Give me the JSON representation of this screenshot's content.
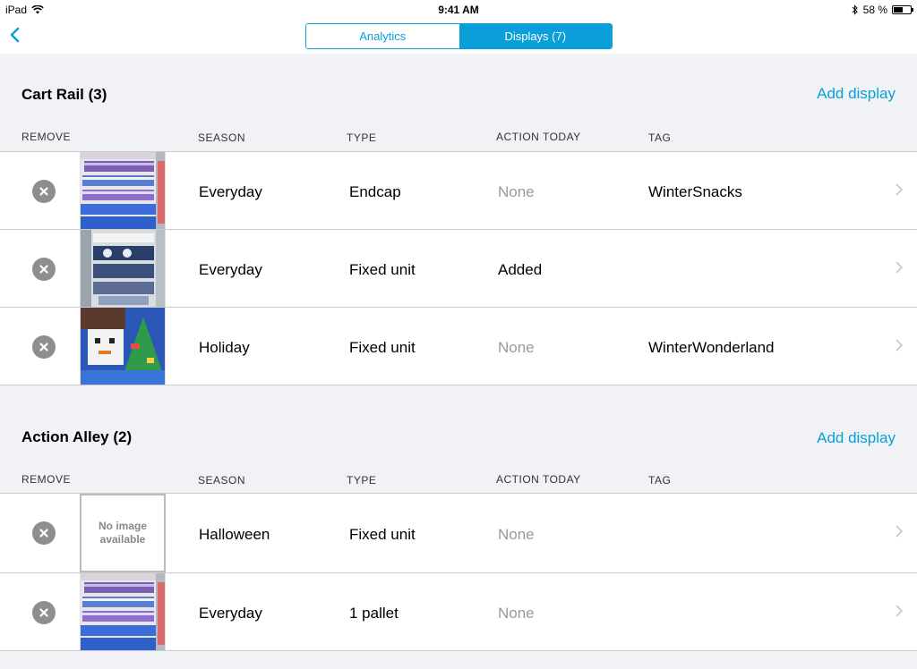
{
  "status": {
    "device": "iPad",
    "time": "9:41 AM",
    "battery": "58 %",
    "battery_level": 0.58
  },
  "nav": {
    "back_icon": "chevron-left-icon",
    "tabs": [
      {
        "label": "Analytics",
        "active": false
      },
      {
        "label": "Displays (7)",
        "active": true
      }
    ]
  },
  "columns": {
    "remove": "REMOVE",
    "season": "SEASON",
    "type": "TYPE",
    "action": "ACTION TODAY",
    "tag": "TAG"
  },
  "sections": [
    {
      "title": "Cart Rail (3)",
      "add_label": "Add display",
      "rows": [
        {
          "image": "shelf-blue",
          "season": "Everyday",
          "type": "Endcap",
          "action": "None",
          "tag": "WinterSnacks"
        },
        {
          "image": "shelf-cart",
          "season": "Everyday",
          "type": "Fixed unit",
          "action": "Added",
          "tag": ""
        },
        {
          "image": "holiday-display",
          "season": "Holiday",
          "type": "Fixed unit",
          "action": "None",
          "tag": "WinterWonderland"
        }
      ]
    },
    {
      "title": "Action Alley (2)",
      "add_label": "Add display",
      "rows": [
        {
          "image": "none",
          "no_image_text": "No image available",
          "season": "Halloween",
          "type": "Fixed unit",
          "action": "None",
          "tag": ""
        },
        {
          "image": "shelf-blue",
          "season": "Everyday",
          "type": "1 pallet",
          "action": "None",
          "tag": ""
        }
      ]
    }
  ],
  "colors": {
    "accent": "#0a9fd8",
    "muted": "#999999",
    "remove": "#8e8e8e"
  }
}
